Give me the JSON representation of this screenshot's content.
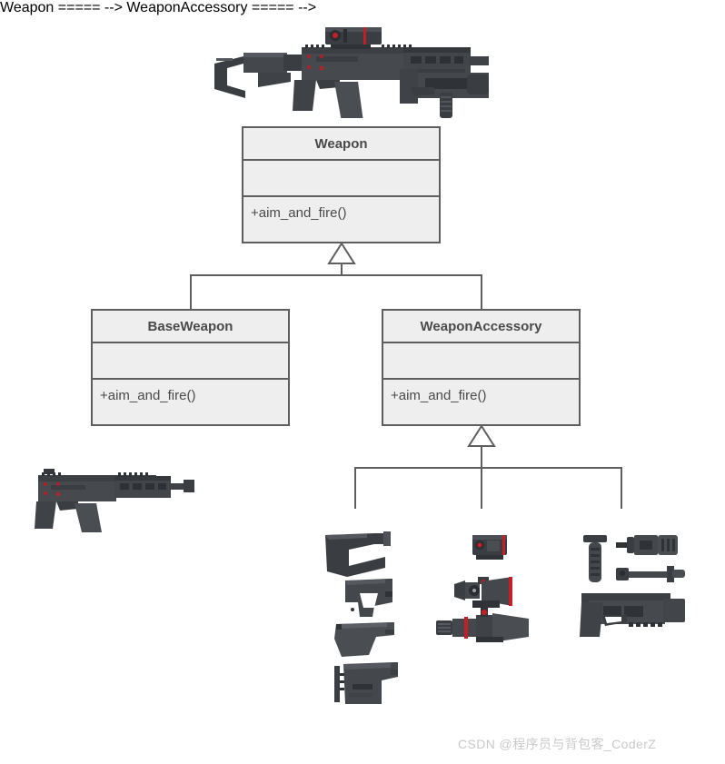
{
  "diagram": {
    "type": "uml-class-diagram",
    "background_color": "#ffffff",
    "box_fill_color": "#eeeeee",
    "box_border_color": "#5e5e5e",
    "text_color": "#4a4a4a",
    "classes": [
      {
        "id": "weapon",
        "name": "Weapon",
        "attributes": [],
        "operations": [
          "+aim_and_fire()"
        ]
      },
      {
        "id": "baseweapon",
        "name": "BaseWeapon",
        "attributes": [],
        "operations": [
          "+aim_and_fire()"
        ]
      },
      {
        "id": "weaponaccessory",
        "name": "WeaponAccessory",
        "attributes": [],
        "operations": [
          "+aim_and_fire()"
        ]
      }
    ],
    "relationships": [
      {
        "type": "generalization",
        "from": "BaseWeapon",
        "to": "Weapon"
      },
      {
        "type": "generalization",
        "from": "WeaponAccessory",
        "to": "Weapon"
      },
      {
        "type": "generalization",
        "from": "stock-group",
        "to": "WeaponAccessory"
      },
      {
        "type": "generalization",
        "from": "optic-group",
        "to": "WeaponAccessory"
      },
      {
        "type": "generalization",
        "from": "grip-group",
        "to": "WeaponAccessory"
      }
    ]
  },
  "illustrations": {
    "assembled_rifle": "assembled-rifle-with-scope-stock-suppressor-image",
    "base_rifle": "base-rifle-receiver-grip-magazine-image",
    "stock_group": "weapon-stock-variants-image",
    "optic_group": "weapon-optic-sights-image",
    "grip_group": "weapon-grip-and-barrel-attachments-image"
  },
  "watermark": {
    "text": "CSDN @程序员与背包客_CoderZ",
    "color": "#c9c9c9"
  }
}
